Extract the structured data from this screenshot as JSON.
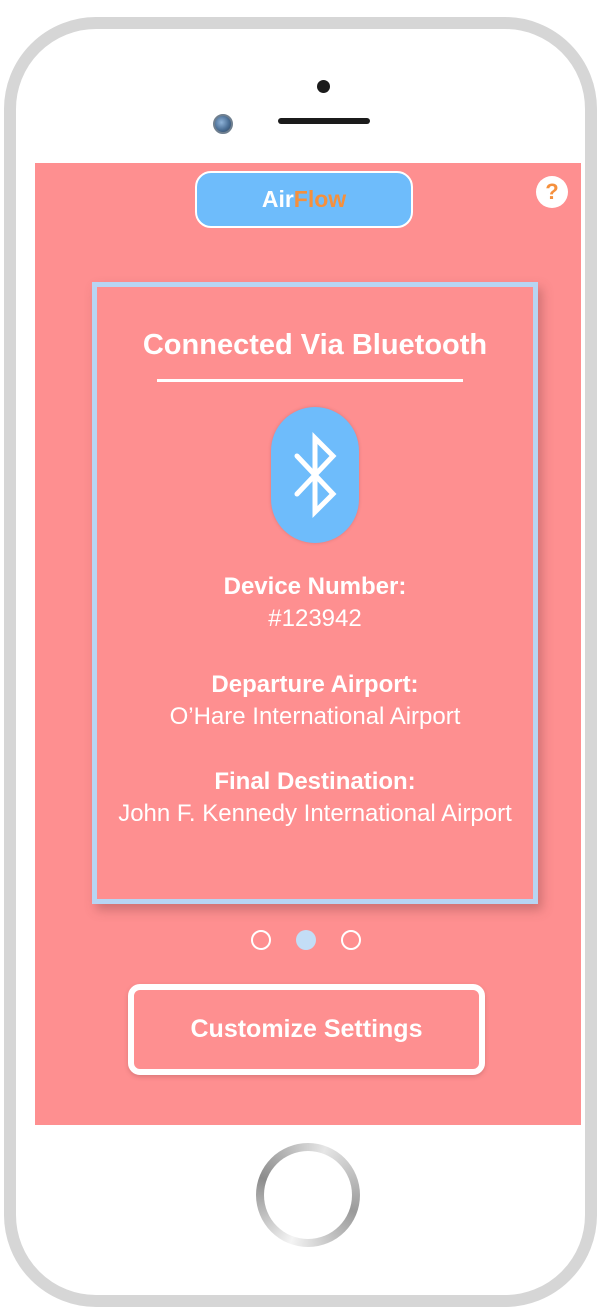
{
  "app": {
    "brand_part1": "Air",
    "brand_part2": "Flow",
    "help_glyph": "?"
  },
  "card": {
    "title": "Connected Via Bluetooth",
    "icon": "bluetooth-icon",
    "fields": [
      {
        "label": "Device Number:",
        "value": "#123942"
      },
      {
        "label": "Departure Airport:",
        "value": "O’Hare International Airport"
      },
      {
        "label": "Final Destination:",
        "value": "John F. Kennedy International Airport"
      }
    ]
  },
  "pagination": {
    "total": 3,
    "active_index": 1
  },
  "actions": {
    "customize_label": "Customize Settings"
  },
  "colors": {
    "screen_bg": "#fe8f90",
    "accent_blue": "#6ebcfb",
    "accent_orange": "#f5903d",
    "card_border": "#b7d5f3"
  }
}
